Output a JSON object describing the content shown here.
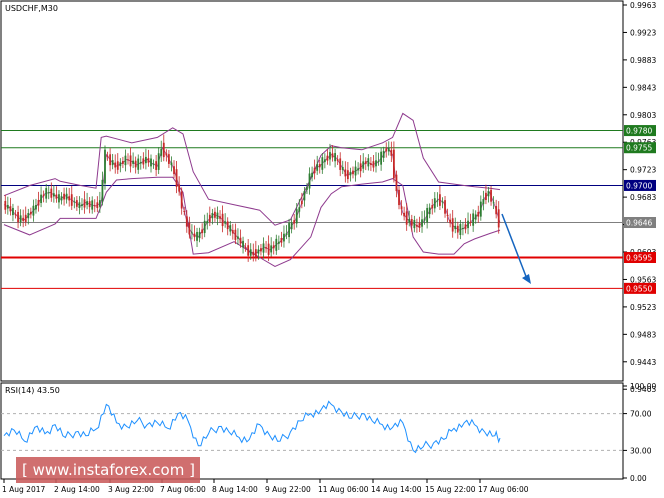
{
  "chart_data": [
    {
      "type": "candlestick",
      "title": "USDCHF,M30",
      "ylim": [
        0.9415,
        0.9963
      ],
      "y_ticks": [
        "0.9963",
        "0.9923",
        "0.9883",
        "0.9843",
        "0.9803",
        "0.9763",
        "0.9723",
        "0.9683",
        "0.9643",
        "0.9603",
        "0.9563",
        "0.9523",
        "0.9483",
        "0.9443",
        "0.9403"
      ],
      "x_ticks": [
        "1 Aug 2017",
        "2 Aug 14:00",
        "3 Aug 22:00",
        "7 Aug 06:00",
        "8 Aug 14:00",
        "9 Aug 22:00",
        "11 Aug 06:00",
        "14 Aug 14:00",
        "15 Aug 22:00",
        "17 Aug 06:00"
      ],
      "series": [
        {
          "kind": "price",
          "x": [
            0,
            2,
            4,
            6,
            8,
            10,
            12,
            14,
            16,
            18,
            20,
            22,
            24,
            26,
            28,
            30,
            32,
            34,
            36,
            38,
            40,
            42,
            44,
            46,
            48,
            50,
            52,
            54,
            56,
            58,
            60,
            62,
            64,
            66,
            68,
            70,
            72,
            74,
            76,
            78,
            80,
            82,
            84,
            86,
            88,
            90,
            92,
            94,
            96,
            98,
            100,
            102,
            104,
            106,
            108,
            110,
            112,
            114,
            116,
            118,
            120,
            122,
            124,
            126,
            128,
            130,
            132,
            134,
            136,
            138,
            140,
            142,
            144,
            146,
            148,
            150,
            152,
            154,
            156,
            158,
            160,
            162,
            164,
            166,
            168,
            170,
            172,
            174,
            176,
            178,
            180,
            182,
            184,
            186,
            188,
            190,
            192,
            194
          ],
          "values": [
            0.9672,
            0.9668,
            0.966,
            0.9652,
            0.965,
            0.9658,
            0.9665,
            0.9678,
            0.9688,
            0.969,
            0.9685,
            0.968,
            0.9685,
            0.968,
            0.9675,
            0.967,
            0.9675,
            0.9672,
            0.967,
            0.9675,
            0.9745,
            0.9735,
            0.9728,
            0.9732,
            0.9738,
            0.9735,
            0.973,
            0.9734,
            0.9738,
            0.9732,
            0.9728,
            0.9755,
            0.9742,
            0.9728,
            0.9705,
            0.967,
            0.964,
            0.9628,
            0.9625,
            0.9636,
            0.965,
            0.9658,
            0.9655,
            0.9648,
            0.964,
            0.963,
            0.9622,
            0.9612,
            0.9603,
            0.96,
            0.9605,
            0.961,
            0.9606,
            0.9612,
            0.9618,
            0.9626,
            0.9638,
            0.965,
            0.967,
            0.969,
            0.9712,
            0.9725,
            0.973,
            0.9738,
            0.9745,
            0.974,
            0.9728,
            0.9715,
            0.9718,
            0.9722,
            0.9728,
            0.9735,
            0.973,
            0.9733,
            0.9742,
            0.9755,
            0.9745,
            0.969,
            0.966,
            0.965,
            0.9645,
            0.964,
            0.9647,
            0.966,
            0.9672,
            0.968,
            0.9675,
            0.965,
            0.964,
            0.9635,
            0.9638,
            0.9645,
            0.9652,
            0.966,
            0.9682,
            0.969,
            0.967,
            0.9646
          ]
        },
        {
          "kind": "bollinger_upper",
          "x": [
            0,
            10,
            20,
            22,
            30,
            36,
            38,
            40,
            44,
            50,
            60,
            66,
            70,
            74,
            80,
            90,
            100,
            106,
            112,
            120,
            124,
            128,
            132,
            140,
            148,
            152,
            156,
            160,
            164,
            170,
            176,
            180,
            184,
            190,
            194
          ],
          "values": [
            0.9685,
            0.97,
            0.971,
            0.9706,
            0.97,
            0.9696,
            0.977,
            0.9772,
            0.9768,
            0.9762,
            0.977,
            0.9784,
            0.9775,
            0.972,
            0.968,
            0.9672,
            0.9664,
            0.9642,
            0.965,
            0.971,
            0.9744,
            0.9758,
            0.9755,
            0.9752,
            0.9762,
            0.977,
            0.9805,
            0.9795,
            0.974,
            0.9705,
            0.9702,
            0.97,
            0.9698,
            0.9696,
            0.9694
          ]
        },
        {
          "kind": "bollinger_lower",
          "x": [
            0,
            10,
            20,
            22,
            30,
            36,
            38,
            40,
            44,
            50,
            60,
            66,
            70,
            74,
            80,
            90,
            100,
            106,
            112,
            120,
            124,
            128,
            132,
            140,
            148,
            152,
            156,
            160,
            164,
            170,
            176,
            180,
            184,
            190,
            194
          ],
          "values": [
            0.9643,
            0.9628,
            0.9644,
            0.9652,
            0.9652,
            0.9652,
            0.967,
            0.969,
            0.9708,
            0.971,
            0.9712,
            0.9712,
            0.969,
            0.96,
            0.9602,
            0.9618,
            0.9595,
            0.9582,
            0.9592,
            0.9625,
            0.9668,
            0.9688,
            0.9698,
            0.9702,
            0.9705,
            0.971,
            0.97,
            0.9625,
            0.9603,
            0.96,
            0.96,
            0.9615,
            0.9622,
            0.963,
            0.9635
          ]
        }
      ],
      "levels": [
        {
          "value": 0.978,
          "label": "0.9780",
          "color": "#1f7a1f"
        },
        {
          "value": 0.9755,
          "label": "0.9755",
          "color": "#1f7a1f"
        },
        {
          "value": 0.97,
          "label": "0.9700",
          "color": "#000080"
        },
        {
          "value": 0.9646,
          "label": "0.9646",
          "color": "#7f7f7f"
        },
        {
          "value": 0.9595,
          "label": "0.9595",
          "color": "#e00000"
        },
        {
          "value": 0.955,
          "label": "0.9550",
          "color": "#e00000"
        }
      ],
      "colors": {
        "up": "#2e7d32",
        "down": "#c62828",
        "band": "#8e3a8e",
        "arrow": "#1565c0"
      }
    },
    {
      "type": "line",
      "title": "RSI(14) 43.50",
      "ylim": [
        0,
        100
      ],
      "y_ticks": [
        "100.00",
        "70.00",
        "30.00",
        "0.00"
      ],
      "guides": [
        70,
        30
      ],
      "series": [
        {
          "x": [
            0,
            4,
            8,
            12,
            16,
            20,
            24,
            28,
            32,
            36,
            40,
            44,
            48,
            52,
            56,
            60,
            64,
            68,
            72,
            76,
            80,
            84,
            88,
            92,
            96,
            100,
            104,
            108,
            112,
            116,
            120,
            124,
            128,
            132,
            136,
            140,
            144,
            148,
            152,
            156,
            160,
            164,
            168,
            172,
            176,
            180,
            184,
            188,
            192,
            194
          ],
          "values": [
            46,
            52,
            40,
            55,
            48,
            58,
            44,
            50,
            46,
            53,
            80,
            60,
            56,
            62,
            58,
            60,
            54,
            70,
            62,
            35,
            48,
            56,
            50,
            44,
            42,
            58,
            46,
            40,
            50,
            62,
            70,
            74,
            80,
            72,
            65,
            70,
            62,
            58,
            55,
            60,
            30,
            34,
            38,
            42,
            54,
            60,
            58,
            50,
            46,
            43.5
          ]
        }
      ],
      "color": "#1e90ff"
    }
  ],
  "watermark": "[ www.instaforex.com ]"
}
